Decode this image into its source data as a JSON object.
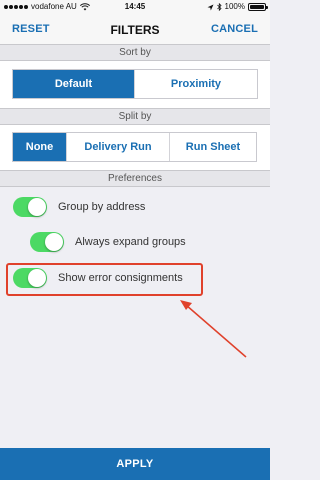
{
  "status_bar": {
    "carrier": "vodafone AU",
    "time": "14:45",
    "battery_text": "100%",
    "battery_level": 1.0
  },
  "nav": {
    "reset_label": "RESET",
    "title": "FILTERS",
    "cancel_label": "CANCEL"
  },
  "sort_by": {
    "header": "Sort by",
    "options": [
      "Default",
      "Proximity"
    ],
    "selected": "Default"
  },
  "split_by": {
    "header": "Split by",
    "options": [
      "None",
      "Delivery Run",
      "Run Sheet"
    ],
    "selected": "None"
  },
  "preferences": {
    "header": "Preferences",
    "items": [
      {
        "label": "Group by address",
        "on": true
      },
      {
        "label": "Always expand groups",
        "on": true
      },
      {
        "label": "Show error consignments",
        "on": true
      }
    ]
  },
  "apply_label": "APPLY",
  "colors": {
    "accent": "#1a6fb3",
    "toggle_on": "#4cd964",
    "annotation": "#e0412b"
  }
}
